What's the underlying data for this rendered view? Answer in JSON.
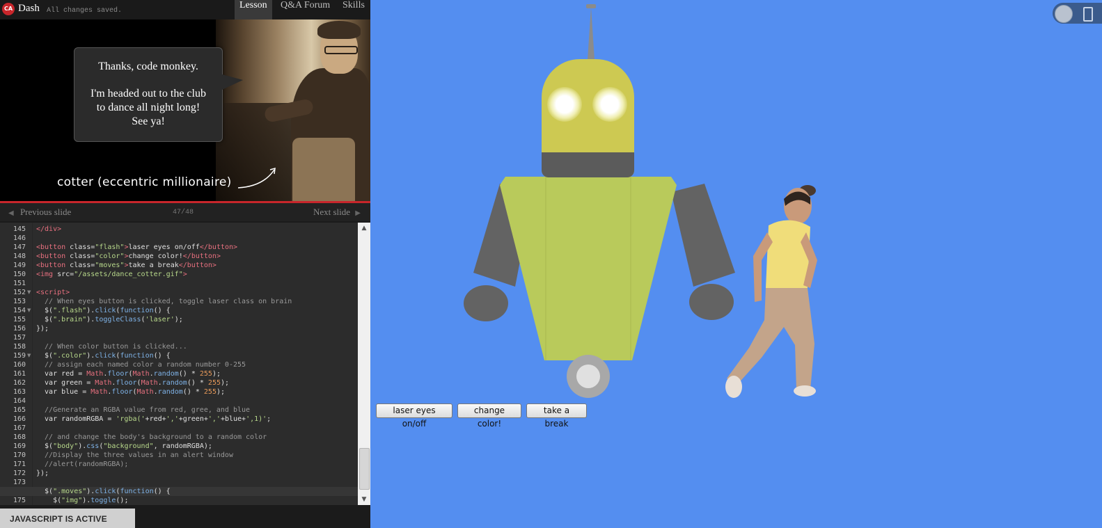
{
  "topbar": {
    "logo": "CA",
    "app_title": "Dash",
    "save_status": "All changes saved.",
    "tabs": [
      {
        "label": "Lesson",
        "active": true
      },
      {
        "label": "Q&A Forum",
        "active": false
      },
      {
        "label": "Skills",
        "active": false
      }
    ]
  },
  "slide": {
    "bubble_line1": "Thanks, code monkey.",
    "bubble_line2": "I'm headed out to the club to dance all night long! See ya!",
    "caption": "cotter (eccentric millionaire)"
  },
  "slidenav": {
    "prev": "Previous slide",
    "next": "Next slide",
    "count": "47/48"
  },
  "editor": {
    "lines": [
      {
        "n": "145",
        "fold": false,
        "hl": false,
        "code": "</div>"
      },
      {
        "n": "146",
        "fold": false,
        "hl": false,
        "code": ""
      },
      {
        "n": "147",
        "fold": false,
        "hl": false,
        "code": "<button class=\"flash\">laser eyes on/off</button>"
      },
      {
        "n": "148",
        "fold": false,
        "hl": false,
        "code": "<button class=\"color\">change color!</button>"
      },
      {
        "n": "149",
        "fold": false,
        "hl": false,
        "code": "<button class=\"moves\">take a break</button>"
      },
      {
        "n": "150",
        "fold": false,
        "hl": false,
        "code": "<img src=\"/assets/dance_cotter.gif\">"
      },
      {
        "n": "151",
        "fold": false,
        "hl": false,
        "code": ""
      },
      {
        "n": "152",
        "fold": true,
        "hl": false,
        "code": "<script>"
      },
      {
        "n": "153",
        "fold": false,
        "hl": false,
        "code": "  // When eyes button is clicked, toggle laser class on brain"
      },
      {
        "n": "154",
        "fold": true,
        "hl": false,
        "code": "  $(\".flash\").click(function() {"
      },
      {
        "n": "155",
        "fold": false,
        "hl": false,
        "code": "  $(\".brain\").toggleClass('laser');"
      },
      {
        "n": "156",
        "fold": false,
        "hl": false,
        "code": "});"
      },
      {
        "n": "157",
        "fold": false,
        "hl": false,
        "code": ""
      },
      {
        "n": "158",
        "fold": false,
        "hl": false,
        "code": "  // When color button is clicked..."
      },
      {
        "n": "159",
        "fold": true,
        "hl": false,
        "code": "  $(\".color\").click(function() {"
      },
      {
        "n": "160",
        "fold": false,
        "hl": false,
        "code": "  // assign each named color a random number 0-255"
      },
      {
        "n": "161",
        "fold": false,
        "hl": false,
        "code": "  var red = Math.floor(Math.random() * 255);"
      },
      {
        "n": "162",
        "fold": false,
        "hl": false,
        "code": "  var green = Math.floor(Math.random() * 255);"
      },
      {
        "n": "163",
        "fold": false,
        "hl": false,
        "code": "  var blue = Math.floor(Math.random() * 255);"
      },
      {
        "n": "164",
        "fold": false,
        "hl": false,
        "code": ""
      },
      {
        "n": "165",
        "fold": false,
        "hl": false,
        "code": "  //Generate an RGBA value from red, gree, and blue"
      },
      {
        "n": "166",
        "fold": false,
        "hl": false,
        "code": "  var randomRGBA = 'rgba('+red+','+green+','+blue+',1)';"
      },
      {
        "n": "167",
        "fold": false,
        "hl": false,
        "code": ""
      },
      {
        "n": "168",
        "fold": false,
        "hl": false,
        "code": "  // and change the body's background to a random color"
      },
      {
        "n": "169",
        "fold": false,
        "hl": false,
        "code": "  $(\"body\").css(\"background\", randomRGBA);"
      },
      {
        "n": "170",
        "fold": false,
        "hl": false,
        "code": "  //Display the three values in an alert window"
      },
      {
        "n": "171",
        "fold": false,
        "hl": false,
        "code": "  //alert(randomRGBA);"
      },
      {
        "n": "172",
        "fold": false,
        "hl": false,
        "code": "});"
      },
      {
        "n": "173",
        "fold": false,
        "hl": false,
        "code": ""
      },
      {
        "n": "174",
        "fold": true,
        "hl": true,
        "code": "  $(\".moves\").click(function() {"
      },
      {
        "n": "175",
        "fold": false,
        "hl": false,
        "code": "    $(\"img\").toggle();"
      }
    ]
  },
  "status": {
    "js_active": "JAVASCRIPT IS ACTIVE"
  },
  "preview": {
    "background": "#548ef0",
    "buttons": {
      "flash": "laser eyes on/off",
      "color": "change color!",
      "moves": "take a break"
    },
    "robot_colors": {
      "head": "#cdc952",
      "torso": "#b9ca5b",
      "limbs": "#636363"
    }
  },
  "icons": {
    "scroll_up": "▲",
    "scroll_down": "▼",
    "prev_arrow": "◀",
    "next_arrow": "▶"
  }
}
